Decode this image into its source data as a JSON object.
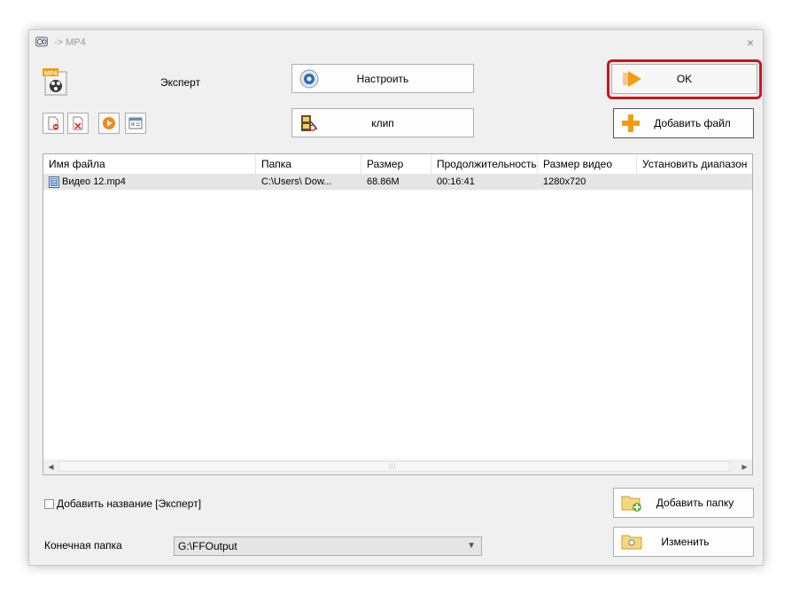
{
  "window": {
    "title": "-> MP4",
    "close_symbol": "×",
    "app_icon": "format-factory-icon"
  },
  "top": {
    "profile_label": "Эксперт",
    "settings_button": "Настроить",
    "clip_button": "клип",
    "ok_button": "OK",
    "add_file_button": "Добавить файл"
  },
  "toolbar": {
    "icons": [
      "remove-file-icon",
      "clear-list-icon",
      "play-icon",
      "media-info-icon"
    ]
  },
  "file_table": {
    "columns": [
      "Имя файла",
      "Папка",
      "Размер",
      "Продолжительность",
      "Размер видео",
      "Установить диапазон"
    ],
    "rows": [
      {
        "name": "Видео 12.mp4",
        "folder": "C:\\Users\\         Dow...",
        "size": "68.86M",
        "duration": "00:16:41",
        "video_size": "1280x720",
        "range": ""
      }
    ]
  },
  "bottom": {
    "add_name_checkbox": "Добавить название [Эксперт]",
    "add_name_checked": false,
    "add_folder_button": "Добавить папку",
    "dest_label": "Конечная папка",
    "dest_value": "G:\\FFOutput",
    "change_button": "Изменить"
  },
  "colors": {
    "highlight": "#c3191e",
    "accent_orange": "#f39c12"
  }
}
